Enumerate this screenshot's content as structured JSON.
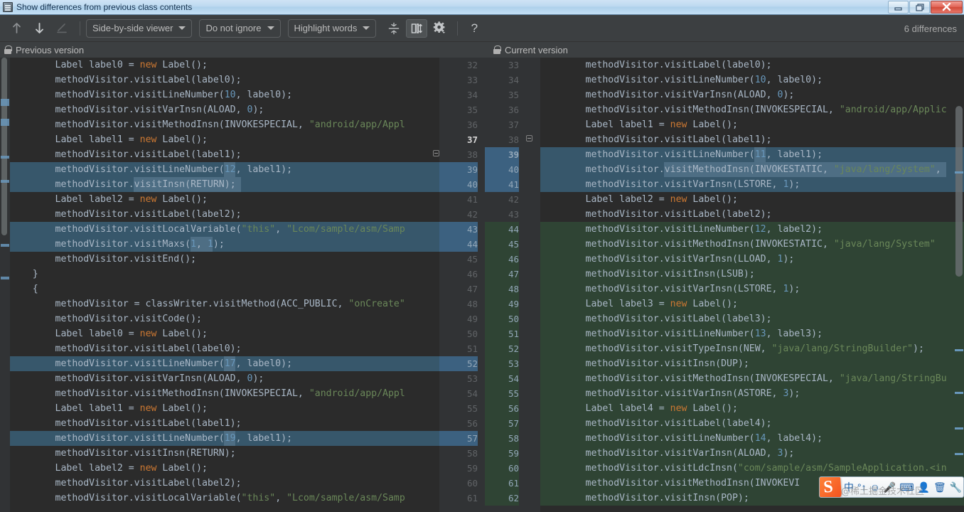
{
  "window": {
    "title": "Show differences from previous class contents",
    "icon": "class-file-icon",
    "controls": {
      "minimize": "minimize-icon",
      "maximize": "restore-icon",
      "close": "close-icon"
    }
  },
  "toolbar": {
    "prev_difference": "previous-difference-icon",
    "next_difference": "next-difference-icon",
    "edit": "edit-icon",
    "viewer_mode": "Side-by-side viewer",
    "ignore_policy": "Do not ignore",
    "highlight_policy": "Highlight words",
    "collapse_unchanged": "collapse-unchanged-icon",
    "sync_scroll": "synchronize-scroll-icon",
    "settings": "gear-icon",
    "help": "?",
    "differences_count": "6 differences"
  },
  "panes": {
    "left": {
      "title": "Previous version",
      "readonly_icon": "lock-icon"
    },
    "right": {
      "title": "Current version",
      "readonly_icon": "lock-icon"
    }
  },
  "left_pane": {
    "first_line_number": 32,
    "lines": [
      {
        "n": 32,
        "text": "        Label label0 = new Label();",
        "diff": "none"
      },
      {
        "n": 33,
        "text": "        methodVisitor.visitLabel(label0);",
        "diff": "none"
      },
      {
        "n": 34,
        "text": "        methodVisitor.visitLineNumber(10, label0);",
        "diff": "none"
      },
      {
        "n": 35,
        "text": "        methodVisitor.visitVarInsn(ALOAD, 0);",
        "diff": "none"
      },
      {
        "n": 36,
        "text": "        methodVisitor.visitMethodInsn(INVOKESPECIAL, \"android/app/Appl",
        "diff": "none"
      },
      {
        "n": 37,
        "text": "        Label label1 = new Label();",
        "diff": "none",
        "current": true
      },
      {
        "n": 38,
        "text": "        methodVisitor.visitLabel(label1);",
        "diff": "none"
      },
      {
        "n": 39,
        "text": "        methodVisitor.visitLineNumber(12, label1);",
        "diff": "modified"
      },
      {
        "n": 40,
        "text": "        methodVisitor.visitInsn(RETURN);",
        "diff": "modified"
      },
      {
        "n": 41,
        "text": "        Label label2 = new Label();",
        "diff": "none"
      },
      {
        "n": 42,
        "text": "        methodVisitor.visitLabel(label2);",
        "diff": "none"
      },
      {
        "n": 43,
        "text": "        methodVisitor.visitLocalVariable(\"this\", \"Lcom/sample/asm/Samp",
        "diff": "modified"
      },
      {
        "n": 44,
        "text": "        methodVisitor.visitMaxs(1, 1);",
        "diff": "modified"
      },
      {
        "n": 45,
        "text": "        methodVisitor.visitEnd();",
        "diff": "none"
      },
      {
        "n": 46,
        "text": "    }",
        "diff": "none"
      },
      {
        "n": 47,
        "text": "    {",
        "diff": "none"
      },
      {
        "n": 48,
        "text": "        methodVisitor = classWriter.visitMethod(ACC_PUBLIC, \"onCreate\"",
        "diff": "none"
      },
      {
        "n": 49,
        "text": "        methodVisitor.visitCode();",
        "diff": "none"
      },
      {
        "n": 50,
        "text": "        Label label0 = new Label();",
        "diff": "none"
      },
      {
        "n": 51,
        "text": "        methodVisitor.visitLabel(label0);",
        "diff": "none"
      },
      {
        "n": 52,
        "text": "        methodVisitor.visitLineNumber(17, label0);",
        "diff": "modified"
      },
      {
        "n": 53,
        "text": "        methodVisitor.visitVarInsn(ALOAD, 0);",
        "diff": "none"
      },
      {
        "n": 54,
        "text": "        methodVisitor.visitMethodInsn(INVOKESPECIAL, \"android/app/Appl",
        "diff": "none"
      },
      {
        "n": 55,
        "text": "        Label label1 = new Label();",
        "diff": "none"
      },
      {
        "n": 56,
        "text": "        methodVisitor.visitLabel(label1);",
        "diff": "none"
      },
      {
        "n": 57,
        "text": "        methodVisitor.visitLineNumber(19, label1);",
        "diff": "modified"
      },
      {
        "n": 58,
        "text": "        methodVisitor.visitInsn(RETURN);",
        "diff": "none"
      },
      {
        "n": 59,
        "text": "        Label label2 = new Label();",
        "diff": "none"
      },
      {
        "n": 60,
        "text": "        methodVisitor.visitLabel(label2);",
        "diff": "none"
      },
      {
        "n": 61,
        "text": "        methodVisitor.visitLocalVariable(\"this\", \"Lcom/sample/asm/Samp",
        "diff": "none"
      }
    ]
  },
  "right_pane": {
    "first_line_number": 33,
    "lines": [
      {
        "n": 33,
        "text": "        methodVisitor.visitLabel(label0);",
        "diff": "none"
      },
      {
        "n": 34,
        "text": "        methodVisitor.visitLineNumber(10, label0);",
        "diff": "none"
      },
      {
        "n": 35,
        "text": "        methodVisitor.visitVarInsn(ALOAD, 0);",
        "diff": "none"
      },
      {
        "n": 36,
        "text": "        methodVisitor.visitMethodInsn(INVOKESPECIAL, \"android/app/Applic",
        "diff": "none"
      },
      {
        "n": 37,
        "text": "        Label label1 = new Label();",
        "diff": "none"
      },
      {
        "n": 38,
        "text": "        methodVisitor.visitLabel(label1);",
        "diff": "none"
      },
      {
        "n": 39,
        "text": "        methodVisitor.visitLineNumber(11, label1);",
        "diff": "modified",
        "current": true
      },
      {
        "n": 40,
        "text": "        methodVisitor.visitMethodInsn(INVOKESTATIC, \"java/lang/System\",",
        "diff": "modified"
      },
      {
        "n": 41,
        "text": "        methodVisitor.visitVarInsn(LSTORE, 1);",
        "diff": "modified"
      },
      {
        "n": 42,
        "text": "        Label label2 = new Label();",
        "diff": "none"
      },
      {
        "n": 43,
        "text": "        methodVisitor.visitLabel(label2);",
        "diff": "none"
      },
      {
        "n": 44,
        "text": "        methodVisitor.visitLineNumber(12, label2);",
        "diff": "added"
      },
      {
        "n": 45,
        "text": "        methodVisitor.visitMethodInsn(INVOKESTATIC, \"java/lang/System\"",
        "diff": "added"
      },
      {
        "n": 46,
        "text": "        methodVisitor.visitVarInsn(LLOAD, 1);",
        "diff": "added"
      },
      {
        "n": 47,
        "text": "        methodVisitor.visitInsn(LSUB);",
        "diff": "added"
      },
      {
        "n": 48,
        "text": "        methodVisitor.visitVarInsn(LSTORE, 1);",
        "diff": "added"
      },
      {
        "n": 49,
        "text": "        Label label3 = new Label();",
        "diff": "added"
      },
      {
        "n": 50,
        "text": "        methodVisitor.visitLabel(label3);",
        "diff": "added"
      },
      {
        "n": 51,
        "text": "        methodVisitor.visitLineNumber(13, label3);",
        "diff": "added"
      },
      {
        "n": 52,
        "text": "        methodVisitor.visitTypeInsn(NEW, \"java/lang/StringBuilder\");",
        "diff": "added"
      },
      {
        "n": 53,
        "text": "        methodVisitor.visitInsn(DUP);",
        "diff": "added"
      },
      {
        "n": 54,
        "text": "        methodVisitor.visitMethodInsn(INVOKESPECIAL, \"java/lang/StringBu",
        "diff": "added"
      },
      {
        "n": 55,
        "text": "        methodVisitor.visitVarInsn(ASTORE, 3);",
        "diff": "added"
      },
      {
        "n": 56,
        "text": "        Label label4 = new Label();",
        "diff": "added"
      },
      {
        "n": 57,
        "text": "        methodVisitor.visitLabel(label4);",
        "diff": "added"
      },
      {
        "n": 58,
        "text": "        methodVisitor.visitLineNumber(14, label4);",
        "diff": "added"
      },
      {
        "n": 59,
        "text": "        methodVisitor.visitVarInsn(ALOAD, 3);",
        "diff": "added"
      },
      {
        "n": 60,
        "text": "        methodVisitor.visitLdcInsn(\"com/sample/asm/SampleApplication.<in",
        "diff": "added"
      },
      {
        "n": 61,
        "text": "        methodVisitor.visitMethodInsn(INVOKEVI",
        "diff": "added"
      },
      {
        "n": 62,
        "text": "        methodVisitor.visitInsn(POP);",
        "diff": "added"
      }
    ]
  },
  "ime_overlay": {
    "logo": "sogou-logo-icon",
    "items": [
      "input-mode-icon",
      "fullwidth-icon",
      "emoji-icon",
      "voice-icon",
      "keyboard-icon",
      "person-icon",
      "toolbox-icon",
      "wrench-icon"
    ],
    "watermark": "@稀土掘金技术社区"
  },
  "colors": {
    "modified": "#37576b",
    "added": "#2f4434",
    "inline": "#4e6e84",
    "editor_bg": "#2b2b2b",
    "gutter_bg": "#313335",
    "chrome_bg": "#3c3f41"
  }
}
